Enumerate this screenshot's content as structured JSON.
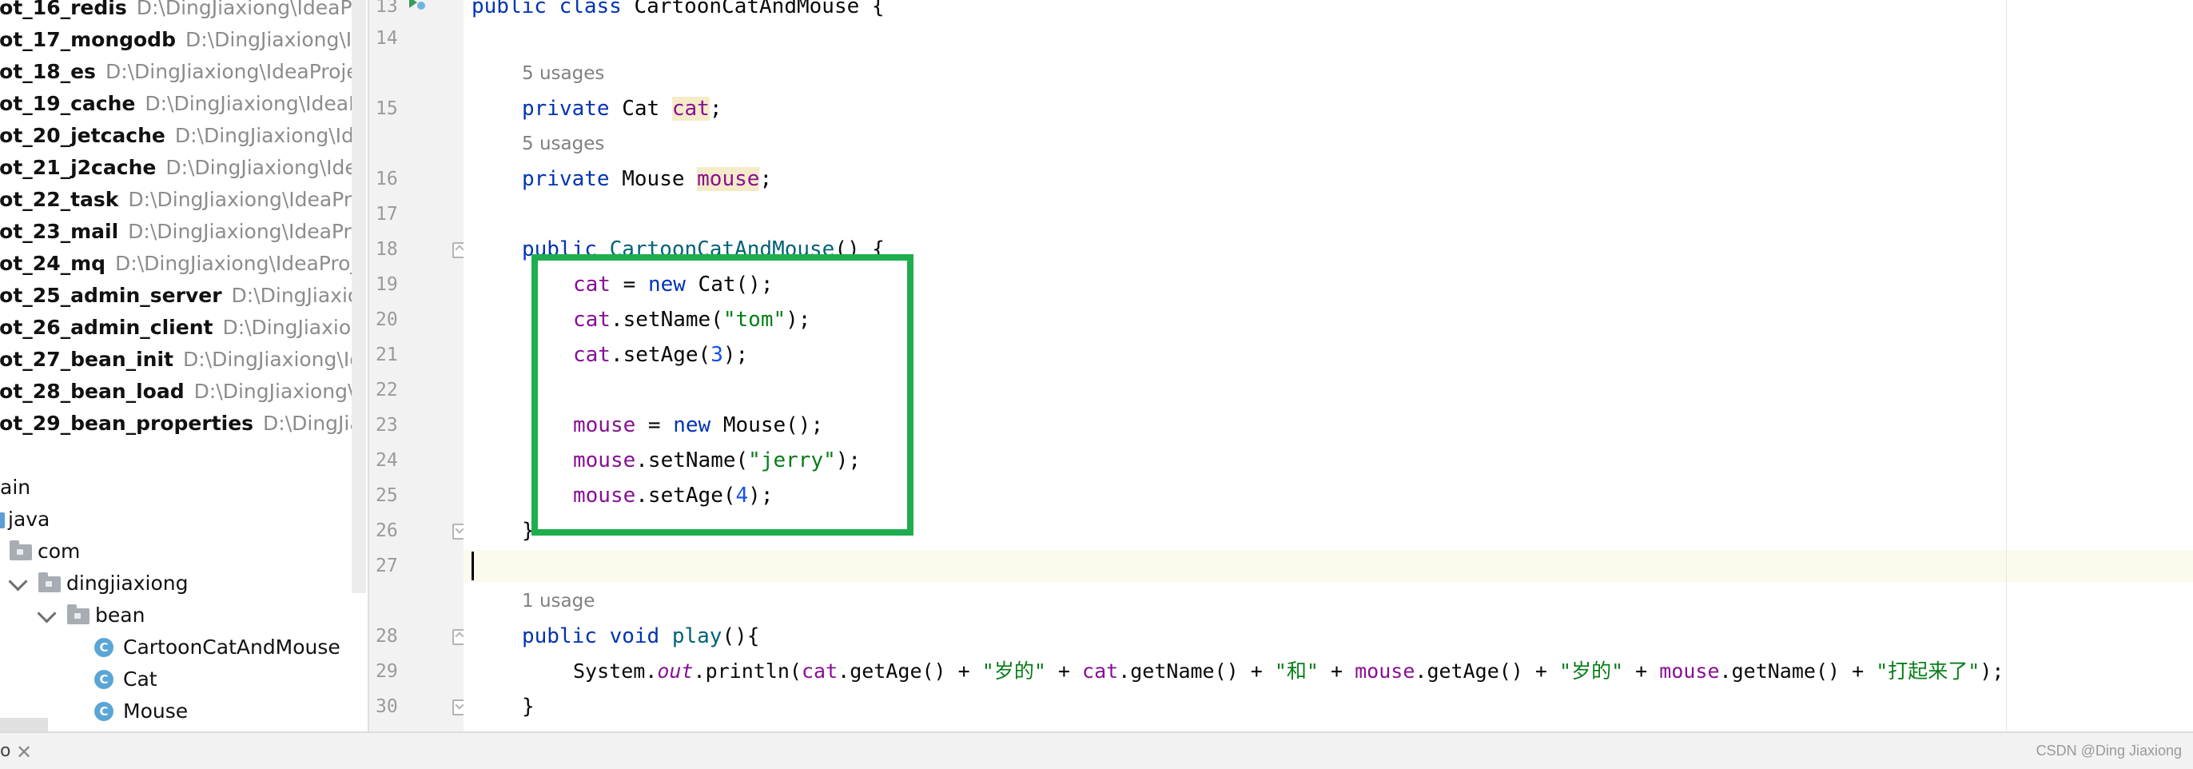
{
  "project_tree": {
    "modules": [
      {
        "name": "oot_16_redis",
        "path": "D:\\DingJiaxiong\\IdeaProjects"
      },
      {
        "name": "oot_17_mongodb",
        "path": "D:\\DingJiaxiong\\IdeaProjects"
      },
      {
        "name": "oot_18_es",
        "path": "D:\\DingJiaxiong\\IdeaProjects"
      },
      {
        "name": "oot_19_cache",
        "path": "D:\\DingJiaxiong\\IdeaProjects"
      },
      {
        "name": "oot_20_jetcache",
        "path": "D:\\DingJiaxiong\\IdeaProjects"
      },
      {
        "name": "oot_21_j2cache",
        "path": "D:\\DingJiaxiong\\IdeaProjects"
      },
      {
        "name": "oot_22_task",
        "path": "D:\\DingJiaxiong\\IdeaProjects"
      },
      {
        "name": "oot_23_mail",
        "path": "D:\\DingJiaxiong\\IdeaProjects"
      },
      {
        "name": "oot_24_mq",
        "path": "D:\\DingJiaxiong\\IdeaProjects"
      },
      {
        "name": "oot_25_admin_server",
        "path": "D:\\DingJiaxiong\\IdeaProjects"
      },
      {
        "name": "oot_26_admin_client",
        "path": "D:\\DingJiaxiong\\IdeaProjects"
      },
      {
        "name": "oot_27_bean_init",
        "path": "D:\\DingJiaxiong\\IdeaProjects"
      },
      {
        "name": "oot_28_bean_load",
        "path": "D:\\DingJiaxiong\\IdeaProjects"
      },
      {
        "name": "oot_29_bean_properties",
        "path": "D:\\DingJiaxiong\\IdeaProjects"
      }
    ],
    "main_label": "ain",
    "java_label": "java",
    "com_label": "com",
    "pkg_label": "dingjiaxiong",
    "bean_label": "bean",
    "classes": [
      "CartoonCatAndMouse",
      "Cat",
      "Mouse"
    ],
    "class_icon_letter": "C"
  },
  "editor": {
    "line_numbers": [
      "13",
      "14",
      "15",
      "16",
      "17",
      "18",
      "19",
      "20",
      "21",
      "22",
      "23",
      "24",
      "25",
      "26",
      "27",
      "28",
      "29",
      "30"
    ],
    "hints": {
      "cat_usages": "5 usages",
      "mouse_usages": "5 usages",
      "play_usages": "1 usage"
    },
    "code": {
      "l13_kw": "public class",
      "l13_name": " CartoonCatAndMouse {",
      "l15_kw": "private",
      "l15_type": " Cat ",
      "l15_field": "cat",
      "l15_end": ";",
      "l16_kw": "private",
      "l16_type": " Mouse ",
      "l16_field": "mouse",
      "l16_end": ";",
      "l18_kw": "public",
      "l18_sp": " ",
      "l18_ctor": "CartoonCatAndMouse",
      "l18_end": "() {",
      "l19_f": "cat",
      "l19_a": " = ",
      "l19_kw": "new",
      "l19_b": " Cat();",
      "l20_f": "cat",
      "l20_a": ".setName(",
      "l20_s": "\"tom\"",
      "l20_b": ");",
      "l21_f": "cat",
      "l21_a": ".setAge(",
      "l21_n": "3",
      "l21_b": ");",
      "l23_f": "mouse",
      "l23_a": " = ",
      "l23_kw": "new",
      "l23_b": " Mouse();",
      "l24_f": "mouse",
      "l24_a": ".setName(",
      "l24_s": "\"jerry\"",
      "l24_b": ");",
      "l25_f": "mouse",
      "l25_a": ".setAge(",
      "l25_n": "4",
      "l25_b": ");",
      "l26": "}",
      "l28_kw": "public void",
      "l28_sp": " ",
      "l28_fn": "play",
      "l28_end": "(){",
      "l29_a": "System.",
      "l29_out": "out",
      "l29_b": ".println(",
      "l29_f1": "cat",
      "l29_c": ".getAge() + ",
      "l29_s1": "\"岁的\"",
      "l29_d": " + ",
      "l29_f2": "cat",
      "l29_e": ".getName() + ",
      "l29_s2": "\"和\"",
      "l29_g": " + ",
      "l29_f3": "mouse",
      "l29_h": ".getAge() + ",
      "l29_s3": "\"岁的\"",
      "l29_i": " + ",
      "l29_f4": "mouse",
      "l29_j": ".getName() + ",
      "l29_s4": "\"打起来了\"",
      "l29_k": ");",
      "l30": "}"
    },
    "highlight_color": "#1fae4f"
  },
  "status_bar": {
    "left_text": "o",
    "close_glyph": "✕",
    "watermark": "CSDN @Ding Jiaxiong"
  }
}
